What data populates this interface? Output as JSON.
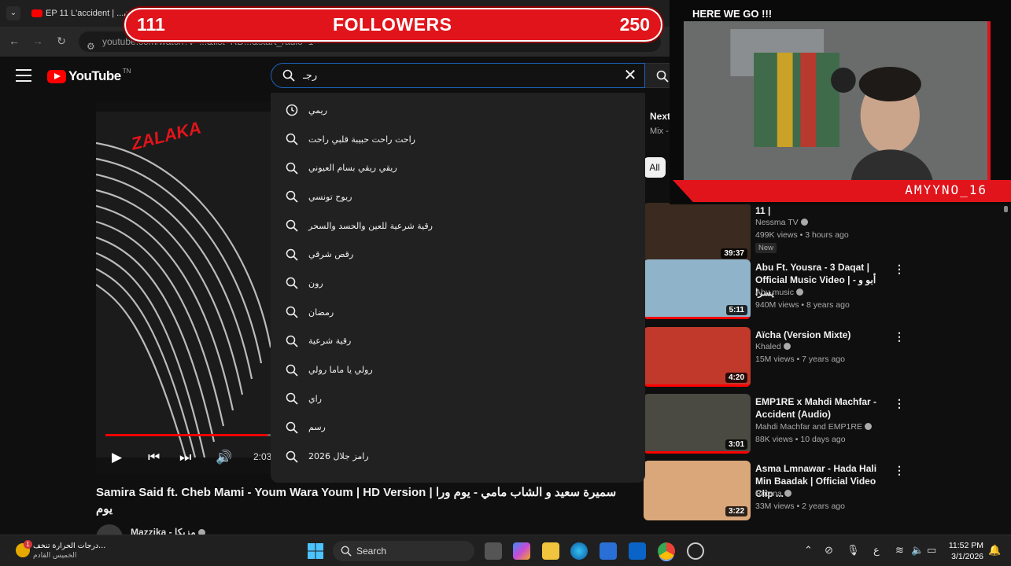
{
  "browser": {
    "tab_title": "EP 11 L'accident | ...سيدون",
    "url": "youtube.com/watch?v=...&list=RD...&start_radio=1"
  },
  "overlay": {
    "followers_current": "111",
    "followers_label": "FOLLOWERS",
    "followers_goal": "250",
    "cam_title": "HERE WE GO !!!",
    "cam_name": "AMYYNO_16"
  },
  "youtube": {
    "logo_text": "YouTube",
    "logo_region": "TN",
    "search_value": "رجـ",
    "suggestions": [
      {
        "text": "ريمي",
        "icon": "history-icon"
      },
      {
        "text": "راحت راحت حبيبة قلبي راحت",
        "icon": "search-icon"
      },
      {
        "text": "ريقي ريقي بسام العيوني",
        "icon": "search-icon"
      },
      {
        "text": "ريوح تونسي",
        "icon": "search-icon"
      },
      {
        "text": "رقية شرعية للعين والحسد والسحر",
        "icon": "search-icon"
      },
      {
        "text": "رقص شرقي",
        "icon": "search-icon"
      },
      {
        "text": "رون",
        "icon": "search-icon"
      },
      {
        "text": "رمضان",
        "icon": "search-icon"
      },
      {
        "text": "رقية شرعية",
        "icon": "search-icon"
      },
      {
        "text": "رولي يا ماما رولي",
        "icon": "search-icon"
      },
      {
        "text": "راي",
        "icon": "search-icon"
      },
      {
        "text": "رسم",
        "icon": "search-icon"
      },
      {
        "text": "رامز جلال 2026",
        "icon": "search-icon"
      }
    ],
    "player": {
      "brand_text": "ZALAKA",
      "time": "2:03",
      "progress_fraction": 0.98
    },
    "video_title": "Samira Said ft. Cheb Mami - Youm Wara Youm | HD Version | سميرة سعيد و الشاب مامي - يوم ورا يوم",
    "channel_name": "Mazzika - مزيكا",
    "sidebar": {
      "next_label": "Next",
      "mix_label": "Mix -",
      "chip_all": "All",
      "videos": [
        {
          "title": "11 |",
          "channel": "Nessma TV",
          "meta": "499K views • 3 hours ago",
          "duration": "39:37",
          "badge": "New",
          "thumb_color": "#3a2a20",
          "progress": 0.4
        },
        {
          "title": "Abu Ft. Yousra - 3 Daqat | Official Music Video | - أبو و يسرا",
          "channel": "Abu music",
          "meta": "940M views • 8 years ago",
          "duration": "5:11",
          "thumb_color": "#8fb3c9",
          "progress": 1.0
        },
        {
          "title": "Aïcha (Version Mixte)",
          "channel": "Khaled",
          "meta": "15M views • 7 years ago",
          "duration": "4:20",
          "thumb_color": "#c0392b",
          "progress": 1.0
        },
        {
          "title": "EMP1RE x Mahdi Machfar - Accident (Audio)",
          "channel": "Mahdi Machfar  and EMP1RE",
          "meta": "88K views • 10 days ago",
          "duration": "3:01",
          "thumb_color": "#4a4a42",
          "progress": 1.0
        },
        {
          "title": "Asma Lmnawar - Hada Hali Min Baadak | Official Video Clip ...",
          "channel": "Rotana",
          "meta": "33M views • 2 years ago",
          "duration": "3:22",
          "thumb_color": "#d9a77a",
          "progress": 0.0
        }
      ]
    }
  },
  "taskbar": {
    "weather_line1": "درجات الحرارة تنخف...",
    "weather_line2": "الخميس القادم",
    "weather_badge": "1",
    "search_label": "Search",
    "lang": "ع",
    "time": "11:52 PM",
    "date": "3/1/2026"
  },
  "colors": {
    "accent_red": "#e1141b",
    "yt_red": "#ff0000",
    "search_border": "#1c62b9"
  }
}
